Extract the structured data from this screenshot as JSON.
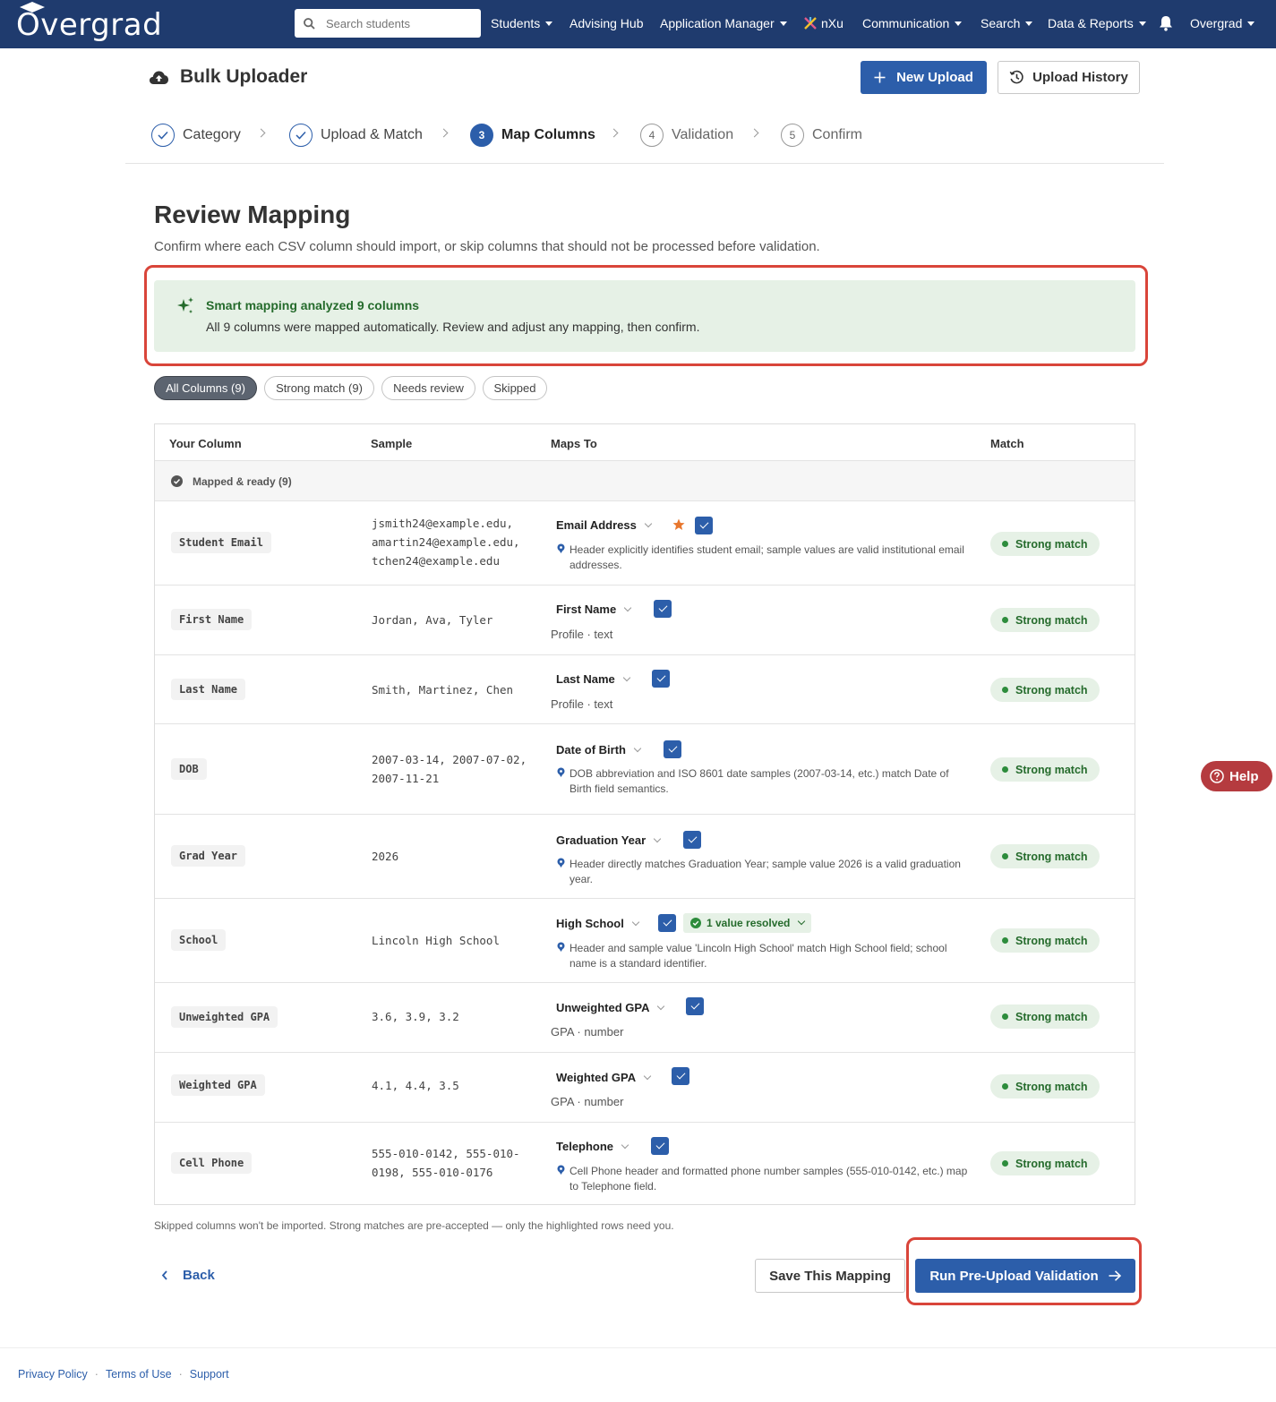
{
  "nav": {
    "brand": "Overgrad",
    "search_placeholder": "Search students",
    "items": [
      {
        "label": "Students",
        "dropdown": true
      },
      {
        "label": "Advising Hub",
        "dropdown": false
      },
      {
        "label": "Application Manager",
        "dropdown": true
      },
      {
        "label": "nXu",
        "dropdown": false
      },
      {
        "label": "Communication",
        "dropdown": true
      },
      {
        "label": "Search",
        "dropdown": true
      },
      {
        "label": "Data & Reports",
        "dropdown": true
      },
      {
        "label": "Overgrad",
        "dropdown": true
      }
    ]
  },
  "header": {
    "title": "Bulk Uploader",
    "new_upload": "New Upload",
    "upload_history": "Upload History"
  },
  "steps": [
    {
      "num": "1",
      "label": "Category",
      "state": "done"
    },
    {
      "num": "2",
      "label": "Upload & Match",
      "state": "done"
    },
    {
      "num": "3",
      "label": "Map Columns",
      "state": "active"
    },
    {
      "num": "4",
      "label": "Validation",
      "state": "todo"
    },
    {
      "num": "5",
      "label": "Confirm",
      "state": "todo"
    }
  ],
  "review": {
    "title": "Review Mapping",
    "subtitle": "Confirm where each CSV column should import, or skip columns that should not be processed before validation."
  },
  "banner": {
    "title": "Smart mapping analyzed 9 columns",
    "body": "All 9 columns were mapped automatically. Review and adjust any mapping, then confirm."
  },
  "filters": [
    {
      "label": "All Columns (9)",
      "active": true
    },
    {
      "label": "Strong match (9)",
      "active": false
    },
    {
      "label": "Needs review",
      "active": false
    },
    {
      "label": "Skipped",
      "active": false
    }
  ],
  "table": {
    "headers": {
      "column": "Your Column",
      "sample": "Sample",
      "maps_to": "Maps To",
      "match": "Match"
    },
    "group_label": "Mapped & ready (9)",
    "rows": [
      {
        "column": "Student Email",
        "sample": "jsmith24@example.edu, amartin24@example.edu, tchen24@example.edu",
        "maps_to": "Email Address",
        "starred": true,
        "meta": "",
        "reason": "Header explicitly identifies student email; sample values are valid institutional email addresses.",
        "resolved": "",
        "match": "Strong match"
      },
      {
        "column": "First Name",
        "sample": "Jordan, Ava, Tyler",
        "maps_to": "First Name",
        "starred": false,
        "meta": "Profile · text",
        "reason": "",
        "resolved": "",
        "match": "Strong match"
      },
      {
        "column": "Last Name",
        "sample": "Smith, Martinez, Chen",
        "maps_to": "Last Name",
        "starred": false,
        "meta": "Profile · text",
        "reason": "",
        "resolved": "",
        "match": "Strong match"
      },
      {
        "column": "DOB",
        "sample": "2007-03-14, 2007-07-02, 2007-11-21",
        "maps_to": "Date of Birth",
        "starred": false,
        "meta": "",
        "reason": "DOB abbreviation and ISO 8601 date samples (2007-03-14, etc.) match Date of Birth field semantics.",
        "resolved": "",
        "match": "Strong match"
      },
      {
        "column": "Grad Year",
        "sample": "2026",
        "maps_to": "Graduation Year",
        "starred": false,
        "meta": "",
        "reason": "Header directly matches Graduation Year; sample value 2026 is a valid graduation year.",
        "resolved": "",
        "match": "Strong match"
      },
      {
        "column": "School",
        "sample": "Lincoln High School",
        "maps_to": "High School",
        "starred": false,
        "meta": "",
        "reason": "Header and sample value 'Lincoln High School' match High School field; school name is a standard identifier.",
        "resolved": "1 value resolved",
        "match": "Strong match"
      },
      {
        "column": "Unweighted GPA",
        "sample": "3.6, 3.9, 3.2",
        "maps_to": "Unweighted GPA",
        "starred": false,
        "meta": "GPA · number",
        "reason": "",
        "resolved": "",
        "match": "Strong match"
      },
      {
        "column": "Weighted GPA",
        "sample": "4.1, 4.4, 3.5",
        "maps_to": "Weighted GPA",
        "starred": false,
        "meta": "GPA · number",
        "reason": "",
        "resolved": "",
        "match": "Strong match"
      },
      {
        "column": "Cell Phone",
        "sample": "555-010-0142, 555-010-0198, 555-010-0176",
        "maps_to": "Telephone",
        "starred": false,
        "meta": "",
        "reason": "Cell Phone header and formatted phone number samples (555-010-0142, etc.) map to Telephone field.",
        "resolved": "",
        "match": "Strong match"
      }
    ]
  },
  "note": "Skipped columns won't be imported. Strong matches are pre-accepted — only the highlighted rows need you.",
  "actions": {
    "back": "Back",
    "save": "Save This Mapping",
    "run": "Run Pre-Upload Validation"
  },
  "help": "Help",
  "footer": [
    "Privacy Policy",
    "Terms of Use",
    "Support"
  ],
  "colors": {
    "nav": "#1f3b6e",
    "primary": "#2c5eaa",
    "success_bg": "#e6f1e6",
    "success_text": "#256b2c",
    "highlight": "#d9453a"
  }
}
